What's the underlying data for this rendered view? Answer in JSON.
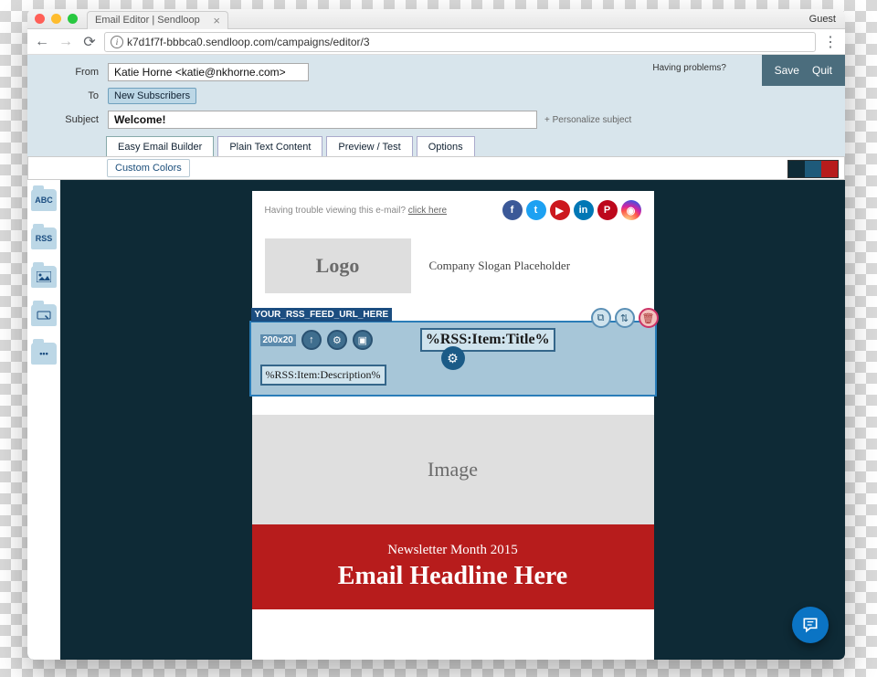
{
  "browser": {
    "tab_title": "Email Editor | Sendloop",
    "guest_label": "Guest",
    "url": "k7d1f7f-bbbca0.sendloop.com/campaigns/editor/3"
  },
  "header": {
    "having_problems": "Having problems?",
    "save": "Save",
    "quit": "Quit"
  },
  "form": {
    "from_label": "From",
    "from_value": "Katie Horne <katie@nkhorne.com>",
    "to_label": "To",
    "to_chip": "New Subscribers",
    "subject_label": "Subject",
    "subject_value": "Welcome!",
    "personalize": "+ Personalize subject"
  },
  "tabs": {
    "t1": "Easy Email Builder",
    "t2": "Plain Text Content",
    "t3": "Preview / Test",
    "t4": "Options"
  },
  "subbar": {
    "custom_colors": "Custom Colors"
  },
  "swatch_colors": {
    "a": "#0e2a36",
    "b": "#1e5a7a",
    "c": "#b71c1c"
  },
  "sidebar": {
    "abc": "ABC",
    "rss": "RSS",
    "img": "",
    "cta": "",
    "more": "•••"
  },
  "email": {
    "trouble_text": "Having trouble viewing this e-mail? ",
    "trouble_link": "click here",
    "logo": "Logo",
    "slogan": "Company Slogan Placeholder",
    "rss_url": "YOUR_RSS_FEED_URL_HERE",
    "rss_dim": "200x20",
    "rss_title": "%RSS:Item:Title%",
    "rss_desc": "%RSS:Item:Description%",
    "image_label": "Image",
    "newsletter_sub": "Newsletter Month 2015",
    "headline": "Email Headline Here"
  },
  "social": {
    "fb": "f",
    "tw": "t",
    "yt": "▶",
    "li": "in",
    "pi": "P",
    "ig": "◉"
  }
}
